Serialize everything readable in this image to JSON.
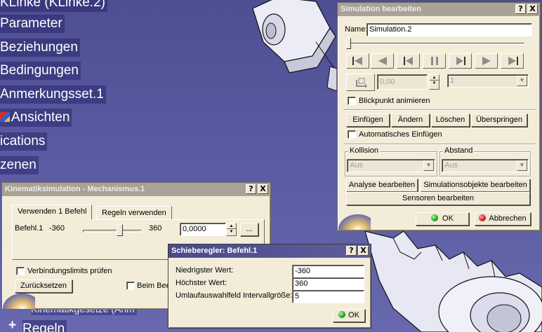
{
  "tree": {
    "items": [
      "KLinke (KLinke.2)",
      "Parameter",
      "Beziehungen",
      "Bedingungen",
      "Anmerkungsset.1",
      "Ansichten",
      "ications",
      "zenen"
    ],
    "bottom_items": [
      "Regeln"
    ],
    "behind_dialog_text": "Kinematikgesetze (Anm"
  },
  "simulation_dialog": {
    "title": "Simulation bearbeiten",
    "help": "?",
    "close": "X",
    "name_label": "Name:",
    "name_value": "Simulation.2",
    "step_value": "0,00",
    "step_combo": "1",
    "checkbox_viewpoint": "Blickpunkt animieren",
    "btn_insert": "Einfügen",
    "btn_modify": "Ändern",
    "btn_delete": "Löschen",
    "btn_skip": "Überspringen",
    "checkbox_auto_insert": "Automatisches Einfügen",
    "group_collision": "Kollision",
    "collision_value": "Aus",
    "group_distance": "Abstand",
    "distance_value": "Aus",
    "btn_edit_analysis": "Analyse bearbeiten",
    "btn_edit_sim_objects": "Simulationsobjekte bearbeiten",
    "btn_edit_sensors": "Sensoren bearbeiten",
    "btn_ok": "OK",
    "btn_cancel": "Abbrechen"
  },
  "kinematics_dialog": {
    "title": "Kinematiksimulation - Mechanismus.1",
    "help": "?",
    "close": "X",
    "tab_use_command": "Verwenden 1 Befehl",
    "tab_use_rules": "Regeln verwenden",
    "command_label": "Befehl.1",
    "slider_min": "-360",
    "slider_max": "360",
    "slider_fraction": 0.64,
    "value": "0,0000",
    "ellipsis": "...",
    "checkbox_limits": "Verbindungslimits prüfen",
    "btn_reset": "Zurücksetzen",
    "checkbox_end": "Beim Beer"
  },
  "slider_dialog": {
    "title": "Schieberegler: Befehl.1",
    "help": "?",
    "close": "X",
    "min_label": "Niedrigster Wert:",
    "min_value": "-360",
    "max_label": "Höchster Wert:",
    "max_value": "360",
    "interval_label": "Umlaufauswahlfeld Intervallgröße:",
    "interval_value": "5",
    "btn_ok": "OK"
  },
  "colors": {
    "viewport": "#5a5aa2",
    "dialog_face": "#f2ecd9",
    "active_title": "#4a4a8a",
    "ok_green": "#109010",
    "cancel_red": "#c01010"
  }
}
